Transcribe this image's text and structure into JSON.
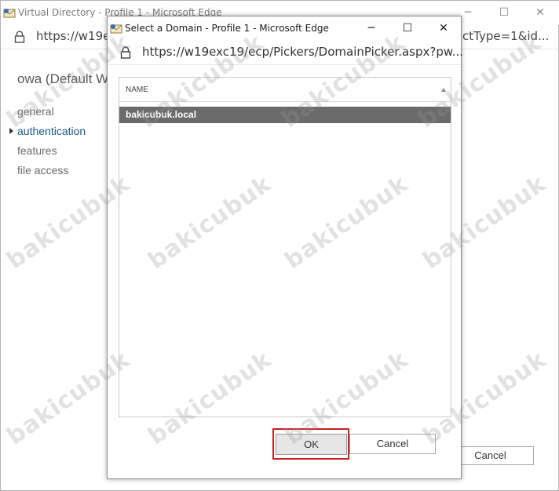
{
  "background_window": {
    "title": "Virtual Directory - Profile 1 - Microsoft Edge",
    "url_left": "https://w19ex",
    "url_right": "ctType=1&id...",
    "heading": "owa (Default W",
    "nav_items": [
      {
        "label": "general"
      },
      {
        "label": "authentication"
      },
      {
        "label": "features"
      },
      {
        "label": "file access"
      }
    ],
    "active_nav": "authentication",
    "cancel_label": "Cancel",
    "controls": {
      "minimize": "─",
      "maximize": "☐",
      "close": "✕"
    }
  },
  "dialog": {
    "title": "Select a Domain - Profile 1 - Microsoft Edge",
    "url": "https://w19exc19/ecp/Pickers/DomainPicker.aspx?pw...",
    "controls": {
      "minimize": "─",
      "maximize": "☐",
      "close": "✕"
    },
    "list": {
      "column_header": "NAME",
      "rows": [
        {
          "name": "bakicubuk.local",
          "selected": true
        }
      ]
    },
    "ok_label": "OK",
    "cancel_label": "Cancel"
  },
  "watermark": {
    "text": "bakicubuk"
  },
  "colors": {
    "selected_row": "#6b6b6b",
    "highlight_border": "#cc1f1f",
    "active_nav": "#1a5a8a"
  }
}
